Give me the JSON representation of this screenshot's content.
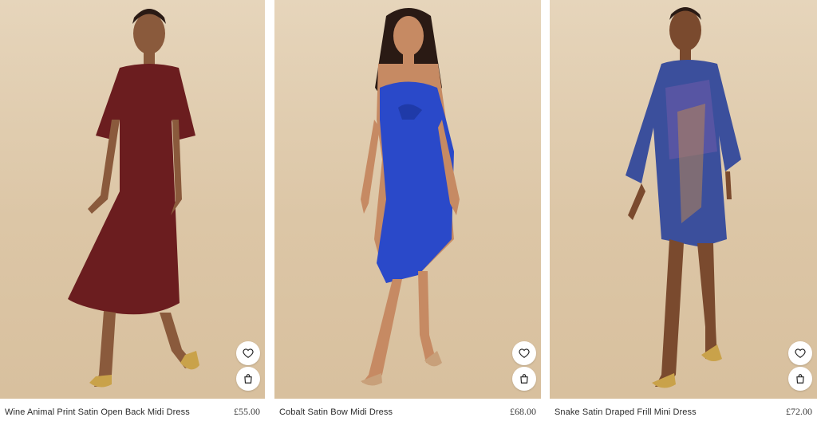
{
  "products": [
    {
      "title": "Wine Animal Print Satin Open Back Midi Dress",
      "price": "£55.00",
      "dress_color": "#6b1d1f",
      "wishlist_icon": "heart-icon",
      "bag_icon": "shopping-bag-icon"
    },
    {
      "title": "Cobalt Satin Bow Midi Dress",
      "price": "£68.00",
      "dress_color": "#2a49c9",
      "wishlist_icon": "heart-icon",
      "bag_icon": "shopping-bag-icon"
    },
    {
      "title": "Snake Satin Draped Frill Mini Dress",
      "price": "£72.00",
      "dress_color": "#3b4f9c",
      "wishlist_icon": "heart-icon",
      "bag_icon": "shopping-bag-icon"
    }
  ]
}
